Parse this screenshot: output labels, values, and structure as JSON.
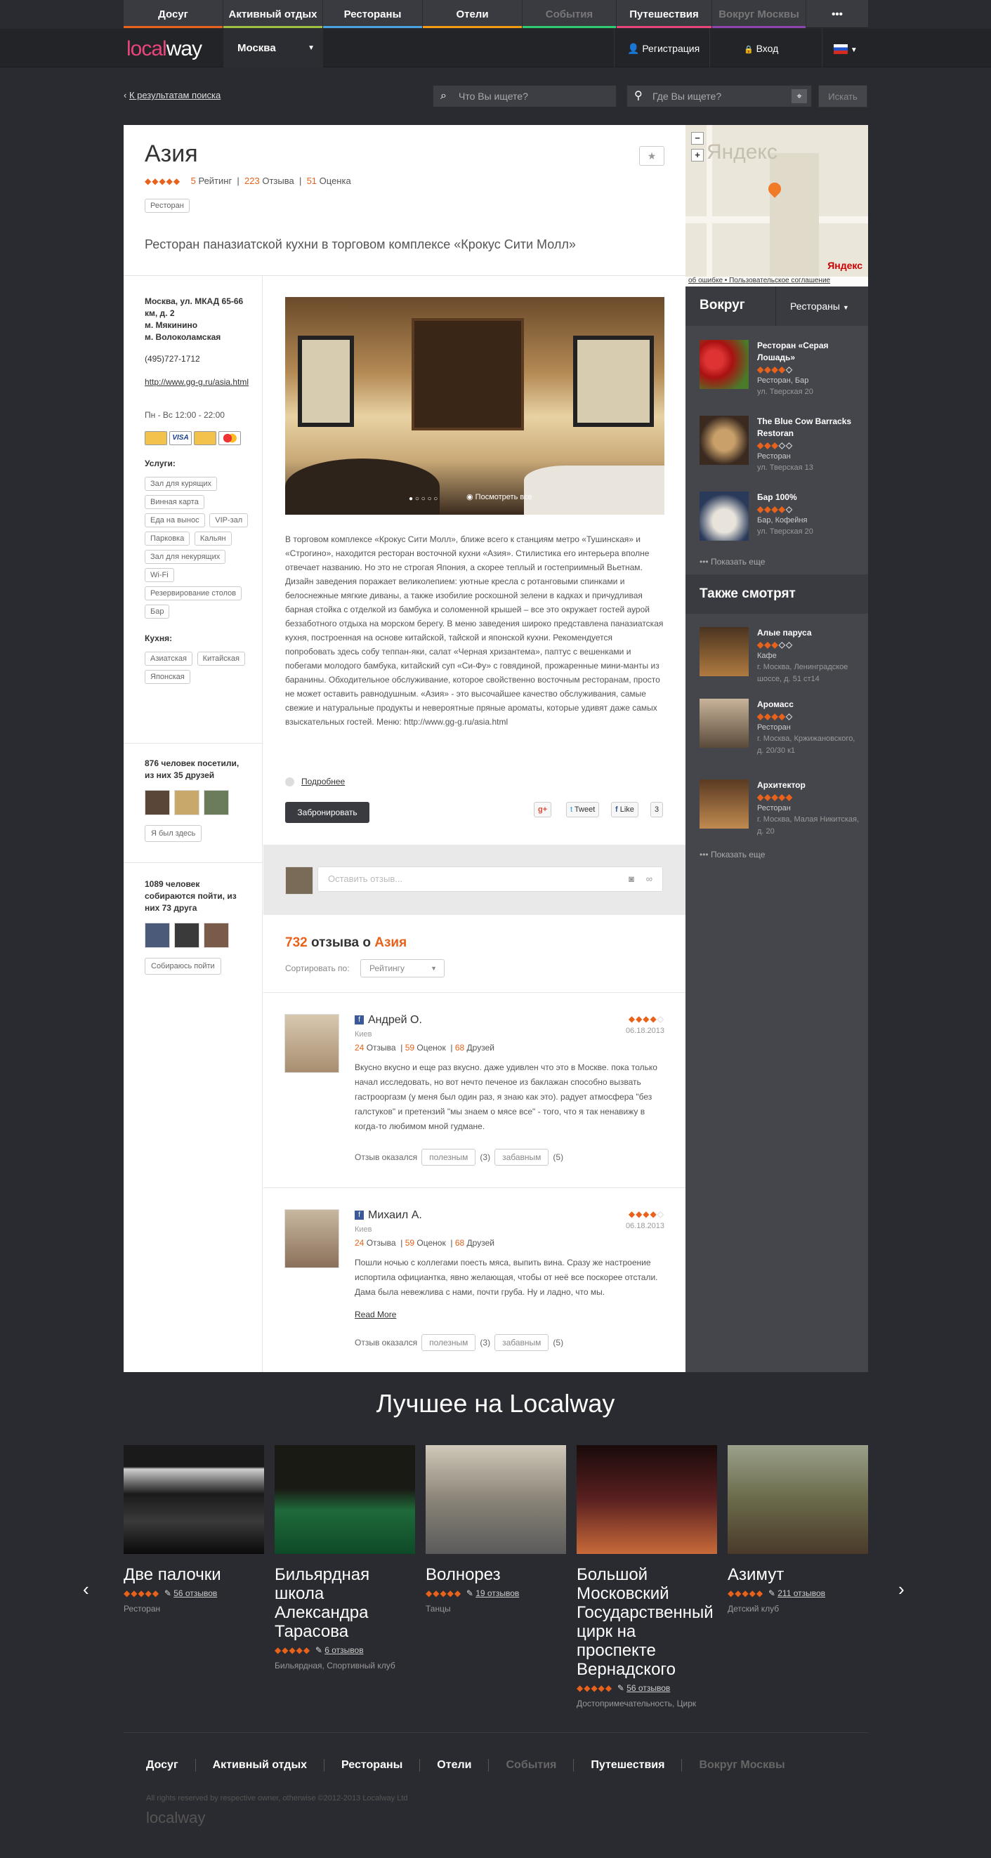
{
  "topnav": {
    "items": [
      "Досуг",
      "Активный отдых",
      "Рестораны",
      "Отели",
      "События",
      "Путешествия",
      "Вокруг Москвы",
      "•••"
    ],
    "colors": [
      "#e8621b",
      "#a0c040",
      "#4aa3df",
      "#f39c12",
      "#888888",
      "#2ecc71",
      "#e8457a",
      "#aaaaaa"
    ]
  },
  "header": {
    "logo_a": "local",
    "logo_b": "way",
    "city": "Москва",
    "register": "Регистрация",
    "login": "Вход"
  },
  "search": {
    "back": "К результатам поиска",
    "what": "Что Вы ищете?",
    "where": "Где Вы ищете?",
    "button": "Искать"
  },
  "place": {
    "title": "Азия",
    "rating_n": "5",
    "rating_l": "Рейтинг",
    "reviews_n": "223",
    "reviews_l": "Отзыва",
    "scores_n": "51",
    "scores_l": "Оценка",
    "tag": "Ресторан",
    "desc": "Ресторан паназиатской кухни в торговом комплексе «Крокус Сити Молл»"
  },
  "info": {
    "address": "Москва, ул. МКАД 65-66 км, д. 2",
    "metro1": "м. Мякинино",
    "metro2": "м. Волоколамская",
    "phone": "(495)727-1712",
    "site": "http://www.gg-g.ru/asia.html",
    "hours": "Пн - Вс 12:00 - 22:00",
    "services_label": "Услуги:",
    "services": [
      "Зал для курящих",
      "Винная карта",
      "Еда на вынос",
      "VIP-зал",
      "Парковка",
      "Кальян",
      "Зал для некурящих",
      "Wi-Fi",
      "Резервирование столов",
      "Бар"
    ],
    "cuisine_label": "Кухня:",
    "cuisine": [
      "Азиатская",
      "Китайская",
      "Японская"
    ],
    "visited": "876 человек посетили, из них 35 друзей",
    "visited_btn": "Я был здесь",
    "going": "1089 человек собираются пойти, из них 73 друга",
    "going_btn": "Собираюсь пойти"
  },
  "photo": {
    "caption": "Посмотреть все"
  },
  "body": {
    "text": "В торговом комплексе «Крокус Сити Молл», ближе всего к станциям метро «Тушинская» и «Строгино», находится ресторан восточной кухни «Азия». Стилистика его интерьера вполне отвечает названию. Но это не строгая Япония, а скорее теплый и гостеприимный Вьетнам. Дизайн заведения поражает великолепием: уютные кресла с ротанговыми спинками и белоснежные мягкие диваны, а также изобилие роскошной зелени в кадках и причудливая барная стойка с отделкой из бамбука и соломенной крышей – все это окружает гостей аурой беззаботного отдыха на морском берегу. В меню заведения широко представлена паназиатская кухня, построенная на основе китайской, тайской и японской кухни. Рекомендуется попробовать здесь собу теппан-яки, салат «Черная хризантема», паптус с вешенками и побегами молодого бамбука, китайский суп «Си-Фу» с говядиной, прожаренные мини-манты из баранины. Обходительное обслуживание, которое свойственно восточным ресторанам, просто не может оставить равнодушным. «Азия» - это высочайшее качество обслуживания, самые свежие и натуральные продукты и невероятные пряные ароматы, которые удивят даже самых взыскательных гостей. Меню: http://www.gg-g.ru/asia.html",
    "more": "Подробнее",
    "book": "Забронировать",
    "gplus": "g+",
    "tweet": "Tweet",
    "like": "Like",
    "like_count": "3"
  },
  "comment": {
    "placeholder": "Оставить отзыв..."
  },
  "reviews": {
    "count": "732",
    "label": "отзыва о",
    "place": "Азия",
    "sort_label": "Сортировать по:",
    "sort_value": "Рейтингу",
    "useful_label": "Отзыв оказался",
    "useful": "полезным",
    "funny": "забавным",
    "items": [
      {
        "name": "Андрей О.",
        "city": "Киев",
        "date": "06.18.2013",
        "n1": "24",
        "l1": "Отзыва",
        "n2": "59",
        "l2": "Оценок",
        "n3": "68",
        "l3": "Друзей",
        "text": "Вкусно вкусно и еще раз вкусно. даже удивлен что это в Москве. пока только начал исследовать, но вот нечто печеное из баклажан способно вызвать гастрооргазм (у меня был один раз, я знаю как это). радует атмосфера \"без галстуков\" и претензий \"мы знаем о мясе все\" - того, что я так ненавижу в когда-то любимом мной гудмане.",
        "useful_n": "(3)",
        "funny_n": "(5)",
        "more": ""
      },
      {
        "name": "Михаил А.",
        "city": "Киев",
        "date": "06.18.2013",
        "n1": "24",
        "l1": "Отзыва",
        "n2": "59",
        "l2": "Оценок",
        "n3": "68",
        "l3": "Друзей",
        "text": "Пошли ночью с коллегами поесть мяса, выпить вина. Сразу же настроение испортила официантка, явно желающая, чтобы от неё все поскорее отстали. Дама была невежлива с нами, почти груба. Ну и ладно, что мы.",
        "useful_n": "(3)",
        "funny_n": "(5)",
        "more": "Read More"
      }
    ]
  },
  "map": {
    "brand": "Яндекс",
    "links": "об ошибке • Пользовательское соглашение"
  },
  "around": {
    "title": "Вокруг",
    "filter": "Рестораны",
    "items": [
      {
        "name": "Ресторан «Серая Лошадь»",
        "type": "Ресторан, Бар",
        "addr": "ул. Тверская 20"
      },
      {
        "name": "The Blue Cow Barracks Restoran",
        "type": "Ресторан",
        "addr": "ул. Тверская 13"
      },
      {
        "name": "Бар 100%",
        "type": "Бар, Кофейня",
        "addr": "ул. Тверская 20"
      }
    ],
    "more": "Показать еще"
  },
  "alsowatch": {
    "title": "Также смотрят",
    "items": [
      {
        "name": "Алые паруса",
        "type": "Кафе",
        "addr": "г. Москва, Ленинградское шоссе, д. 51 ст14"
      },
      {
        "name": "Аромасс",
        "type": "Ресторан",
        "addr": "г. Москва, Кржижановского, д. 20/30 к1"
      },
      {
        "name": "Архитектор",
        "type": "Ресторан",
        "addr": "г. Москва, Малая Никитская, д. 20"
      }
    ],
    "more": "Показать еще"
  },
  "best": {
    "title": "Лучшее на Localway",
    "items": [
      {
        "name": "Две палочки",
        "reviews": "56 отзывов",
        "cat": "Ресторан"
      },
      {
        "name": "Бильярдная школа Александра Тарасова",
        "reviews": "6 отзывов",
        "cat": "Бильярдная, Спортивный клуб"
      },
      {
        "name": "Волнорез",
        "reviews": "19 отзывов",
        "cat": "Танцы"
      },
      {
        "name": "Большой Московский Государственный цирк на проспекте Вернадского",
        "reviews": "56 отзывов",
        "cat": "Достопримечательность, Цирк"
      },
      {
        "name": "Азимут",
        "reviews": "211 отзывов",
        "cat": "Детский клуб"
      }
    ]
  },
  "footer": {
    "items": [
      "Досуг",
      "Активный отдых",
      "Рестораны",
      "Отели",
      "События",
      "Путешествия",
      "Вокруг Москвы"
    ],
    "copy": "All rights reserved by respective owner, otherwise ©2012-2013 Localway Ltd",
    "logo": "localway"
  }
}
